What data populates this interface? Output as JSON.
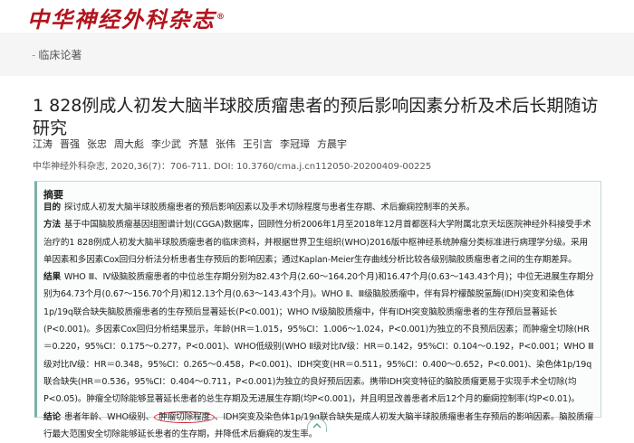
{
  "journal": {
    "logo_text": "中华神经外科杂志",
    "logo_mark": "®"
  },
  "breadcrumb": {
    "section": "临床论著"
  },
  "article": {
    "title": "1 828例成人初发大脑半球胶质瘤患者的预后影响因素分析及术后长期随访研究",
    "authors": [
      "江涛",
      "晋强",
      "张忠",
      "周大彪",
      "李少武",
      "齐慧",
      "张伟",
      "王引言",
      "李冠璋",
      "方晨宇"
    ],
    "citation": "中华神经外科杂志, 2020,36(7)：706-711. DOI: 10.3760/cma.j.cn112050-20200409-00225"
  },
  "abstract": {
    "heading": "摘要",
    "objective": {
      "label": "目的",
      "text": "探讨成人初发大脑半球胶质瘤患者的预后影响因素以及手术切除程度与患者生存期、术后癫痫控制率的关系。"
    },
    "methods": {
      "label": "方法",
      "text": "基于中国脑胶质瘤基因组图谱计划(CGGA)数据库，回顾性分析2006年1月至2018年12月首都医科大学附属北京天坛医院神经外科接受手术治疗的1 828例成人初发大脑半球胶质瘤患者的临床资料，并根据世界卫生组织(WHO)2016版中枢神经系统肿瘤分类标准进行病理学分级。采用单因素和多因素Cox回归分析法分析患者生存预后的影响因素；通过Kaplan-Meier生存曲线分析比较各级别脑胶质瘤患者之间的生存期差异。"
    },
    "results": {
      "label": "结果",
      "text": "WHO Ⅲ、Ⅳ级脑胶质瘤患者的中位总生存期分别为82.43个月(2.60～164.20个月)和16.47个月(0.63～143.43个月)；中位无进展生存期分别为64.73个月(0.67～156.70个月)和12.13个月(0.63～143.43个月)。WHO Ⅱ、Ⅲ级脑胶质瘤中，伴有异柠檬酸脱氢酶(IDH)突变和染色体1p/19q联合缺失脑胶质瘤患者的生存预后显著延长(P<0.001)；WHO Ⅳ级脑胶质瘤中，伴有IDH突变脑胶质瘤患者的生存预后显著延长(P<0.001)。多因素Cox回归分析结果显示，年龄(HR＝1.015，95%CI：1.006～1.024，P<0.001)为独立的不良预后因素；而肿瘤全切除(HR＝0.220，95%CI：0.175～0.277，P<0.001)、WHO低级别(WHO Ⅱ级对比Ⅳ级：HR＝0.142，95%CI：0.104～0.192，P<0.001；WHO Ⅲ级对比Ⅳ级：HR＝0.348，95%CI：0.265～0.458，P<0.001)、IDH突变(HR＝0.511，95%CI：0.400～0.652，P<0.001)、染色体1p/19q联合缺失(HR＝0.536，95%CI：0.404～0.711，P<0.001)为独立的良好预后因素。携带IDH突变特征的脑胶质瘤更易于实现手术全切除(均P<0.05)。肿瘤全切除能够显著延长患者的总生存期及无进展生存期(均P<0.001)，并且明显改善患者术后12个月的癫痫控制率(均P<0.01)。"
    },
    "conclusion": {
      "label": "结论",
      "pre": "患者年龄、WHO级别、",
      "circled": "肿瘤切除程度",
      "post": "、IDH突变及染色体1p/19q联合缺失是成人初发大脑半球胶质瘤患者生存预后的影响因素。脑胶质瘤行最大范围安全切除能够延长患者的生存期，并降低术后癫痫的发生率。"
    }
  },
  "colors": {
    "brand": "#b3141c",
    "accent": "#7fb0a9",
    "highlight": "#d4202c"
  },
  "icons": {
    "expand_toggle": "chevron-up-icon"
  }
}
